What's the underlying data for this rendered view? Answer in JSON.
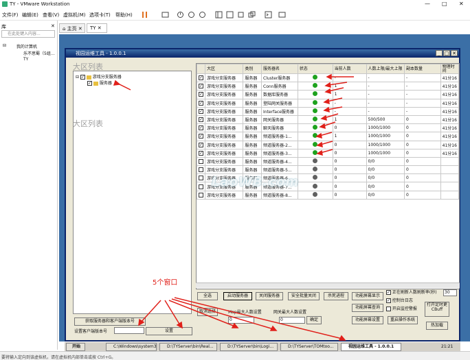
{
  "window": {
    "title": "TY - VMware Workstation",
    "controls": [
      "—",
      "□",
      "✕"
    ]
  },
  "menu": [
    "文件(F)",
    "编辑(E)",
    "查看(V)",
    "虚拟机(M)",
    "选项卡(T)",
    "帮助(H)"
  ],
  "sidebar": {
    "title": "库",
    "search_placeholder": "在此处键入内容...",
    "tree": [
      "我的计算机",
      "乐不思蜀（5组…",
      "TY"
    ]
  },
  "tabs": [
    "主页",
    "TY"
  ],
  "app": {
    "title": "视园运维工具 - 1.0.0.1",
    "region_title": "大区列表",
    "region_title2": "大区列表",
    "tree": {
      "root": "游戏分支服务器",
      "child": "服务器"
    },
    "columns": [
      "大区",
      "类别",
      "服务器名",
      "状态",
      "当前人数",
      "人数上限/最大上限",
      "副本数量",
      "物理时间"
    ],
    "rows": [
      {
        "region": "游戏分支服务器",
        "type": "服务器",
        "name": "Cluster服务器",
        "status": "on",
        "cur": "-",
        "max": "-",
        "copy": "-",
        "time": "41分16"
      },
      {
        "region": "游戏分支服务器",
        "type": "服务器",
        "name": "Conn服务器",
        "status": "on",
        "cur": "1",
        "max": "-",
        "copy": "-",
        "time": "41分16"
      },
      {
        "region": "游戏分支服务器",
        "type": "服务器",
        "name": "数据库服务器",
        "status": "on",
        "cur": "1",
        "max": "-",
        "copy": "-",
        "time": "41分16"
      },
      {
        "region": "游戏分支服务器",
        "type": "服务器",
        "name": "登陆网关服务器",
        "status": "on",
        "cur": "-",
        "max": "-",
        "copy": "-",
        "time": "41分16"
      },
      {
        "region": "游戏分支服务器",
        "type": "服务器",
        "name": "Interface服务器",
        "status": "on",
        "cur": "-",
        "max": "-",
        "copy": "-",
        "time": "41分16"
      },
      {
        "region": "游戏分支服务器",
        "type": "服务器",
        "name": "网关服务器",
        "status": "on",
        "cur": "1",
        "max": "500/500",
        "copy": "0",
        "time": "41分16"
      },
      {
        "region": "游戏分支服务器",
        "type": "服务器",
        "name": "聊天服务器",
        "status": "on",
        "cur": "0",
        "max": "1000/1000",
        "copy": "0",
        "time": "41分16"
      },
      {
        "region": "游戏分支服务器",
        "type": "服务器",
        "name": "频道服务器-1...",
        "status": "on",
        "cur": "1",
        "max": "1000/1000",
        "copy": "0",
        "time": "41分16"
      },
      {
        "region": "游戏分支服务器",
        "type": "服务器",
        "name": "频道服务器-2...",
        "status": "on",
        "cur": "0",
        "max": "1000/1000",
        "copy": "0",
        "time": "41分16"
      },
      {
        "region": "游戏分支服务器",
        "type": "服务器",
        "name": "频道服务器-3...",
        "status": "on",
        "cur": "0",
        "max": "1000/1000",
        "copy": "0",
        "time": "41分16"
      },
      {
        "region": "游戏分支服务器",
        "type": "服务器",
        "name": "频道服务器-4...",
        "status": "off",
        "cur": "0",
        "max": "0/0",
        "copy": "0",
        "time": ""
      },
      {
        "region": "游戏分支服务器",
        "type": "服务器",
        "name": "频道服务器-5...",
        "status": "off",
        "cur": "0",
        "max": "0/0",
        "copy": "0",
        "time": ""
      },
      {
        "region": "游戏分支服务器",
        "type": "服务器",
        "name": "频道服务器-6...",
        "status": "off",
        "cur": "0",
        "max": "0/0",
        "copy": "0",
        "time": ""
      },
      {
        "region": "游戏分支服务器",
        "type": "服务器",
        "name": "频道服务器-7...",
        "status": "off",
        "cur": "0",
        "max": "0/0",
        "copy": "0",
        "time": ""
      },
      {
        "region": "游戏分支服务器",
        "type": "服务器",
        "name": "频道服务器-8...",
        "status": "off",
        "cur": "0",
        "max": "0/0",
        "copy": "0",
        "time": ""
      }
    ],
    "buttons": {
      "select_all": "全选",
      "start": "启动服务器",
      "stop": "关闭服务器",
      "safe_close": "安全批量关闭",
      "kill": "杀死进程",
      "func_show": "功能屏幕显示",
      "func_query": "功能屏幕查询",
      "func_set": "功能屏幕设置",
      "restart_sys": "重启操作系统",
      "hotload": "热加载",
      "timer": "打开定时更CBuff",
      "cancel_sel": "取消选择",
      "get_version": "获取服务器和客户端版本号",
      "set": "设置",
      "confirm": "确定"
    },
    "checks": {
      "refresh": "正在刷新人数刷新率(秒)",
      "refresh_val": "30",
      "console_log": "控制台日志",
      "open_monitor": "开启监控警报"
    },
    "labels": {
      "map_max": "Map最大人数设置",
      "net_max": "网关最大人数设置",
      "client_ver": "设置客户端版本号"
    },
    "inputs": {
      "map_max": "0",
      "net_max": "0"
    }
  },
  "taskbar": {
    "start": "开始",
    "tasks": [
      "C:\\Windows\\system3...",
      "D:\\TYServer\\bin\\Real...",
      "D:\\TYServer\\bin\\Logi...",
      "D:\\TYServer\\TOMtoo...",
      "视园运维工具 - 1.0.0.1"
    ],
    "clock": "21:21"
  },
  "statusbar": "要将输入定向到该虚拟机，请在虚拟机内部单击或按 Ctrl+G。",
  "annotation": "5个窗口",
  "watermark": "LaoWB.com"
}
